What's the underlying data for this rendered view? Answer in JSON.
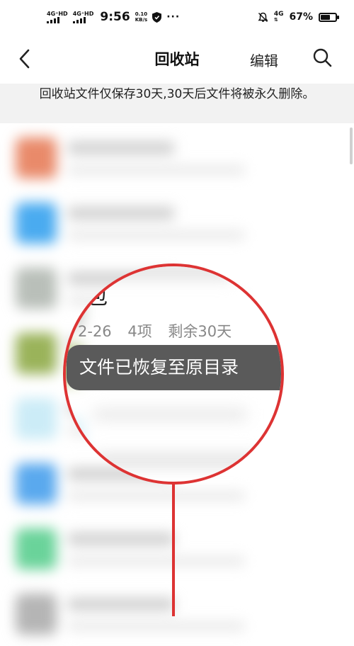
{
  "status_bar": {
    "signal1": "4G⁺HD",
    "signal2": "4G⁺HD",
    "time": "9:56",
    "speed_value": "0.10",
    "speed_unit": "KB/s",
    "more": "···",
    "network_right": "4G",
    "battery_percent": "67%",
    "battery_level": 0.67
  },
  "nav": {
    "title": "回收站",
    "edit_label": "编辑"
  },
  "notice": {
    "text": "回收站文件仅保存30天,30天后文件将被永久删除。"
  },
  "magnifier": {
    "fragment_char": "包",
    "date_fragment": "2-26",
    "item_count": "4项",
    "days_left": "剩余30天",
    "toast_text": "文件已恢复至原目录"
  },
  "colors": {
    "accent_red": "#dd3333",
    "toast_bg": "#5a5a5a",
    "notice_bg": "#f2f2f2"
  },
  "blurred_icon_colors": [
    "#e98a6a",
    "#4aabf0",
    "#b9bfb9",
    "#9ab35a",
    "#ccecf7",
    "#5aa9ee",
    "#6ad39a",
    "#b5b5b5"
  ]
}
